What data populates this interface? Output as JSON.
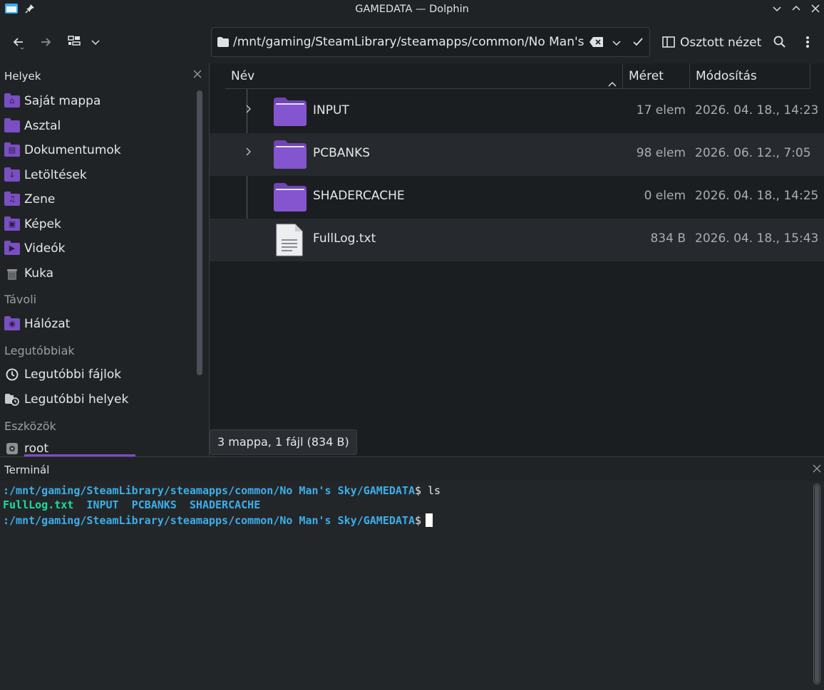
{
  "window": {
    "title": "GAMEDATA — Dolphin"
  },
  "toolbar": {
    "location_path": "/mnt/gaming/SteamLibrary/steamapps/common/No Man's Sky/GAMEDATA",
    "split_view_label": "Osztott nézet"
  },
  "places": {
    "header": "Helyek",
    "items": [
      {
        "label": "Saját mappa",
        "icon": "home-folder-icon"
      },
      {
        "label": "Asztal",
        "icon": "desktop-folder-icon"
      },
      {
        "label": "Dokumentumok",
        "icon": "documents-folder-icon"
      },
      {
        "label": "Letöltések",
        "icon": "downloads-folder-icon"
      },
      {
        "label": "Zene",
        "icon": "music-folder-icon"
      },
      {
        "label": "Képek",
        "icon": "pictures-folder-icon"
      },
      {
        "label": "Videók",
        "icon": "videos-folder-icon"
      },
      {
        "label": "Kuka",
        "icon": "trash-icon"
      }
    ],
    "remote_header": "Távoli",
    "remote_items": [
      {
        "label": "Hálózat",
        "icon": "network-folder-icon"
      }
    ],
    "recent_header": "Legutóbbiak",
    "recent_items": [
      {
        "label": "Legutóbbi fájlok",
        "icon": "recent-files-icon"
      },
      {
        "label": "Legutóbbi helyek",
        "icon": "recent-places-icon"
      }
    ],
    "devices_header": "Eszközök",
    "device_items": [
      {
        "label": "root",
        "icon": "drive-icon"
      }
    ]
  },
  "fileview": {
    "columns": {
      "name": "Név",
      "size": "Méret",
      "modified": "Módosítás"
    },
    "rows": [
      {
        "name": "INPUT",
        "size": "17 elem",
        "modified": "2026. 04. 18., 14:23",
        "type": "folder"
      },
      {
        "name": "PCBANKS",
        "size": "98 elem",
        "modified": "2026. 06. 12., 7:05",
        "type": "folder"
      },
      {
        "name": "SHADERCACHE",
        "size": "0 elem",
        "modified": "2026. 04. 18., 14:25",
        "type": "folder"
      },
      {
        "name": "FullLog.txt",
        "size": "834 B",
        "modified": "2026. 04. 18., 15:43",
        "type": "file"
      }
    ],
    "status": "3 mappa, 1 fájl (834 B)"
  },
  "terminal": {
    "header": "Terminál",
    "prompt_path": ":/mnt/gaming/SteamLibrary/steamapps/common/No Man's Sky/GAMEDATA",
    "prompt_symbol": "$",
    "command": " ls",
    "ls_output": [
      "FullLog.txt",
      "INPUT",
      "PCBANKS",
      "SHADERCACHE"
    ]
  },
  "colors": {
    "folder": "#7a4fc2",
    "accent": "#3daee9",
    "file_green": "#1cdc9a"
  }
}
